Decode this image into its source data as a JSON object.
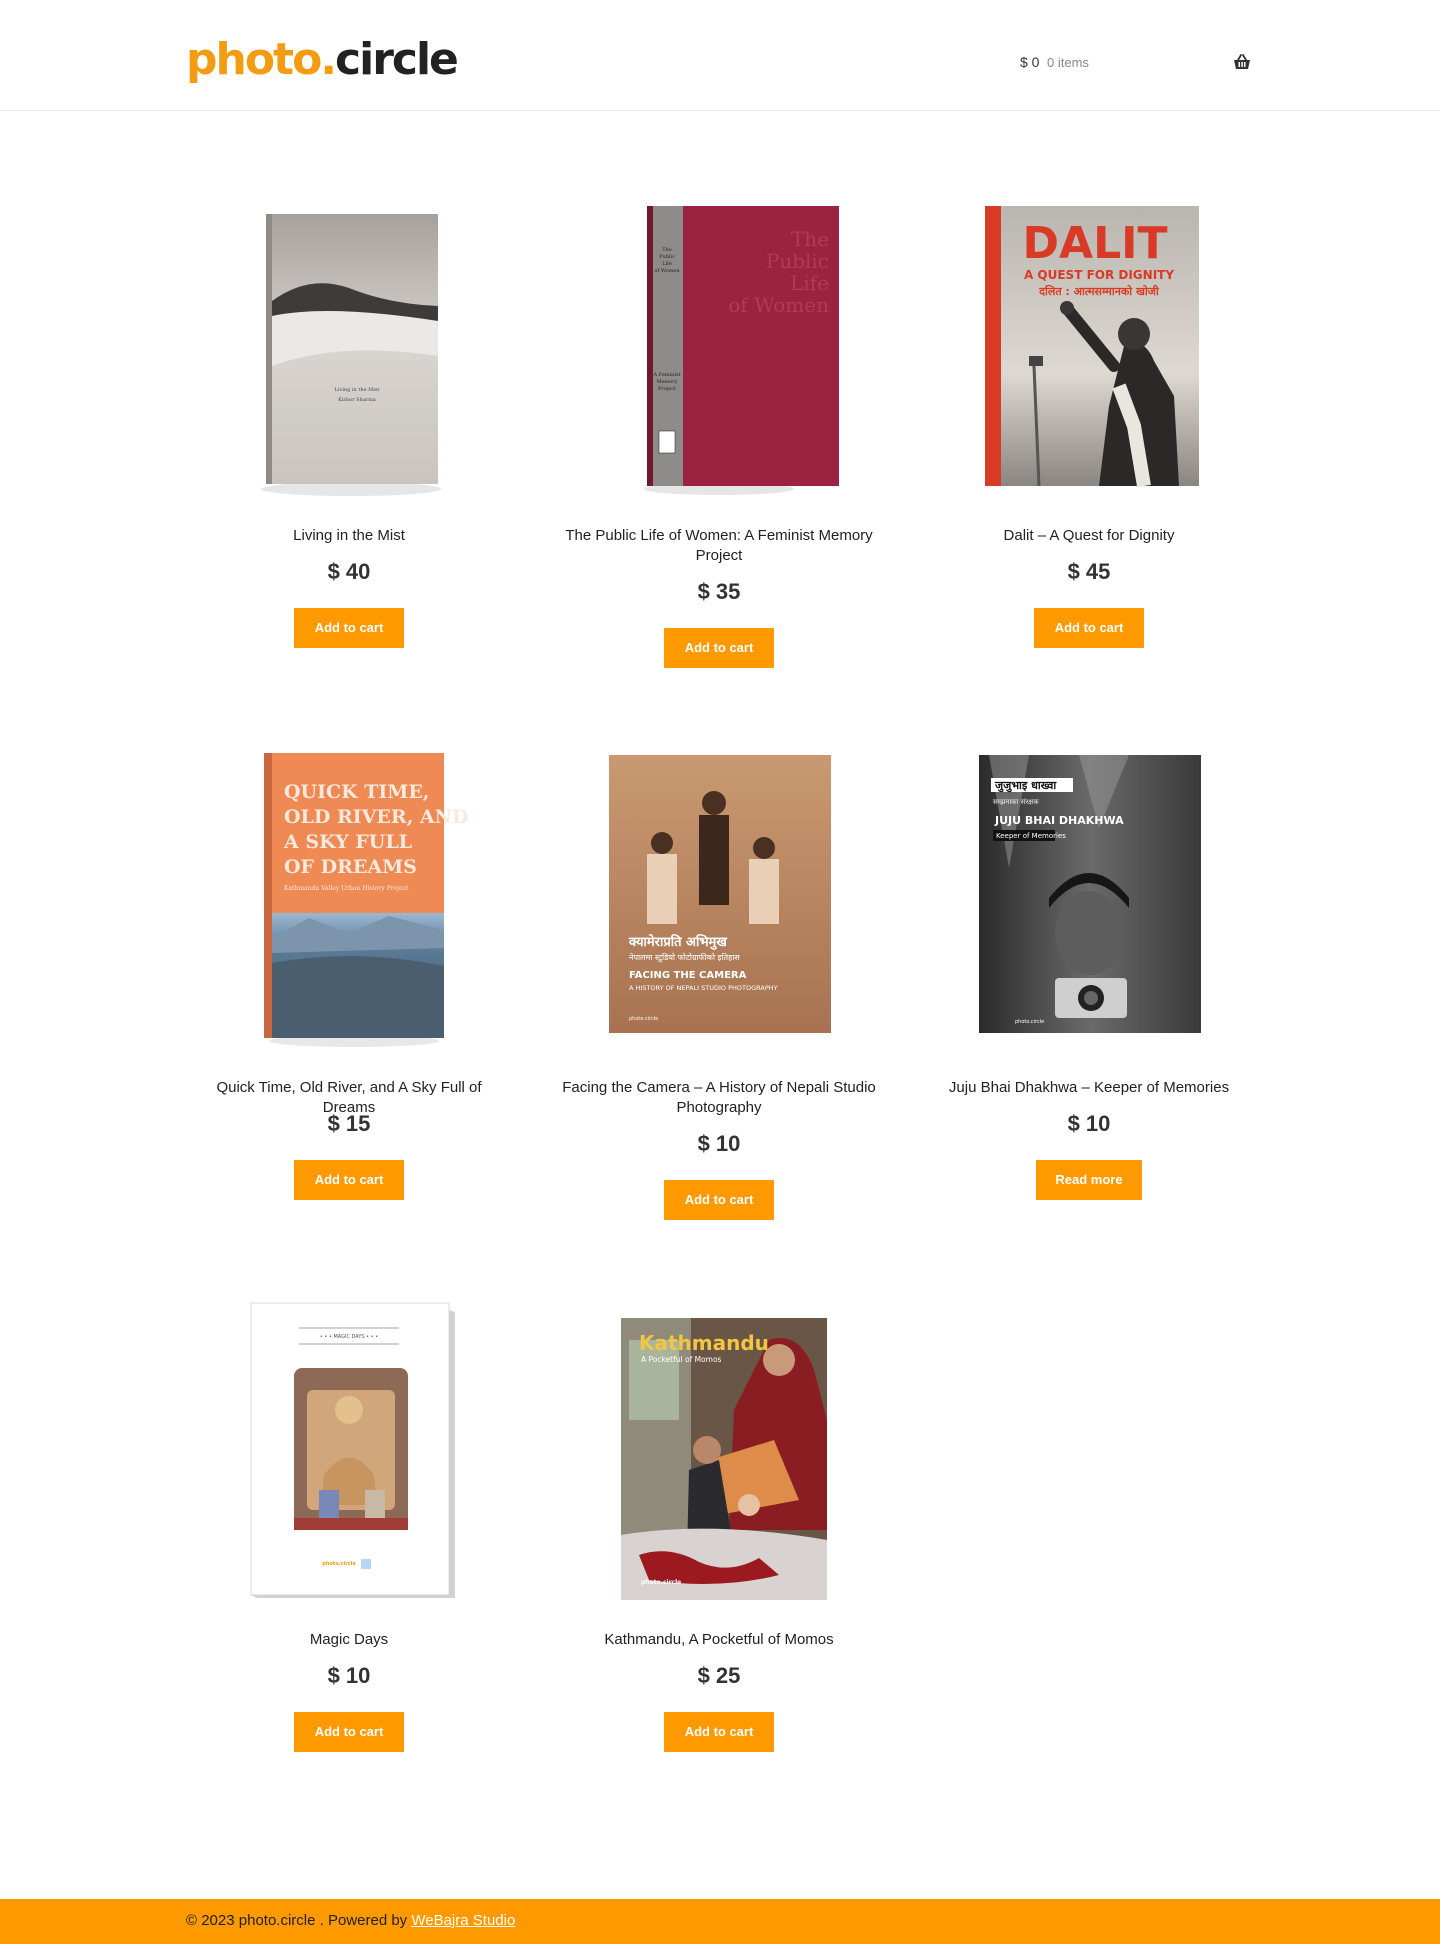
{
  "site": {
    "logo_part1": "photo",
    "logo_dot": ".",
    "logo_part2": "circle",
    "brand_color": "#ff9900"
  },
  "cart": {
    "amount": "$ 0",
    "items": "0 items",
    "icon": "basket-icon"
  },
  "products": [
    {
      "title": "Living in the Mist",
      "price": "$ 40",
      "button": "Add to cart"
    },
    {
      "title": "The Public Life of Women: A Feminist Memory Project",
      "price": "$ 35",
      "button": "Add to cart"
    },
    {
      "title": "Dalit – A Quest for Dignity",
      "price": "$ 45",
      "button": "Add to cart"
    },
    {
      "title": "Quick Time, Old River, and A Sky Full of Dreams",
      "price": "$ 15",
      "button": "Add to cart"
    },
    {
      "title": "Facing the Camera – A History of Nepali Studio Photography",
      "price": "$ 10",
      "button": "Add to cart"
    },
    {
      "title": "Juju Bhai Dhakhwa – Keeper of Memories",
      "price": "$ 10",
      "button": "Read more"
    },
    {
      "title": "Magic Days",
      "price": "$ 10",
      "button": "Add to cart"
    },
    {
      "title": "Kathmandu, A Pocketful of Momos",
      "price": "$ 25",
      "button": "Add to cart"
    }
  ],
  "covers": {
    "mist_lines": [
      "Living in the Mist",
      "Kishor Sharma"
    ],
    "women_spine": [
      "The",
      "Public",
      "Life",
      "of Women"
    ],
    "women_spine2": [
      "A Feminist",
      "Memory",
      "Project"
    ],
    "women_front": [
      "The",
      "Public",
      "Life",
      "of Women"
    ],
    "dalit_title": "DALIT",
    "dalit_sub": "A QUEST FOR DIGNITY",
    "dalit_nepali": "दलित : आत्मसम्मानको खोजी",
    "quick_lines": [
      "QUICK TIME,",
      "OLD RIVER, AND",
      "A SKY FULL",
      "OF DREAMS"
    ],
    "quick_sub": "Kathmandu Valley Urban History Project",
    "facing_nepali": "क्यामेराप्रति अभिमुख",
    "facing_nepali2": "नेपालमा स्टुडियो फोटोग्राफीको इतिहास",
    "facing_title": "FACING THE CAMERA",
    "facing_sub": "A HISTORY OF NEPALI STUDIO PHOTOGRAPHY",
    "facing_brand": "photo.circle",
    "juju_nepali": "जुजुभाइ धाख्वा",
    "juju_nepali2": "सम्झनाका संरक्षक",
    "juju_title": "JUJU BHAI DHAKHWA",
    "juju_sub": "Keeper of Memories",
    "juju_brand": "photo.circle",
    "magic_header": "• • • MAGIC DAYS • • •",
    "magic_brand": "photo.circle",
    "ktm_title": "Kathmandu",
    "ktm_sub": "A Pocketful of Momos",
    "ktm_brand": "photo.circle"
  },
  "footer": {
    "text": "© 2023 photo.circle . Powered by ",
    "link": "WeBajra Studio"
  }
}
